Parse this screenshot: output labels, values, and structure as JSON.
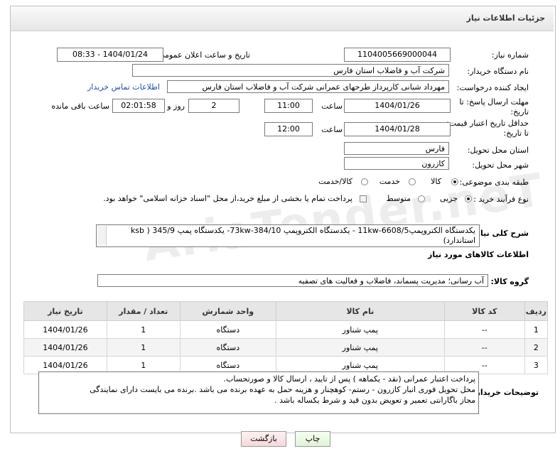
{
  "header": {
    "title": "جزئیات اطلاعات نیاز"
  },
  "form": {
    "need_number_label": "شماره نیاز:",
    "need_number": "1104005669000044",
    "announce_label": "تاریخ و ساعت اعلان عمومی:",
    "announce_value": "1404/01/24 - 08:33",
    "buyer_label": "نام دستگاه خریدار:",
    "buyer_value": "شرکت آب و فاضلاب استان فارس",
    "requester_label": "ایجاد کننده درخواست:",
    "requester_value": "مهرداد شبانی کارپرداز طرحهای عمرانی  شرکت آب و فاضلاب استان فارس",
    "contact_link": "اطلاعات تماس خریدار",
    "send_deadline_label_1": "مهلت ارسال پاسخ: تا",
    "send_deadline_label_2": "تاریخ:",
    "send_date": "1404/01/26",
    "time_label": "ساعت",
    "send_time": "11:00",
    "days_value": "2",
    "days_label": "روز و",
    "remaining_value": "02:01:58",
    "remaining_label": "ساعت باقی مانده",
    "price_deadline_label_1": "حداقل تاریخ اعتبار قیمت:",
    "price_deadline_label_2": "تا تاریخ:",
    "price_date": "1404/01/28",
    "price_time": "12:00",
    "province_label": "استان محل تحویل:",
    "province_value": "فارس",
    "city_label": "شهر محل تحویل:",
    "city_value": "کازرون",
    "category_label": "طبقه بندی موضوعی:",
    "category_options": [
      "کالا",
      "خدمت",
      "کالا/خدمت"
    ],
    "process_label": "نوع فرآیند خرید :",
    "process_options": [
      "جزیی",
      "متوسط"
    ],
    "payment_note": "پرداخت تمام یا بخشی از مبلغ خرید،از محل \"اسناد خزانه اسلامی\" خواهد بود.",
    "summary_label": "شرح کلی نیاز:",
    "summary_line1": "یکدستگاه الکتروپمپ11kw-6608/5 - یکدستگاه الکتروپمپ 73kw-384/10-  یکدستگاه پمپ 345/9  ( ksb",
    "summary_line2": "استاندارد)"
  },
  "goods": {
    "section_title": "اطلاعات کالاهای مورد نیاز",
    "group_label": "گروه کالا:",
    "group_value": "آب رسانی؛ مدیریت پسماند، فاضلاب و فعالیت های تصفیه",
    "columns": [
      "ردیف",
      "کد کالا",
      "نام کالا",
      "واحد شمارش",
      "تعداد / مقدار",
      "تاریخ نیاز"
    ],
    "rows": [
      {
        "row": "1",
        "code": "--",
        "name": "پمپ شناور",
        "unit": "دستگاه",
        "qty": "1",
        "date": "1404/01/26"
      },
      {
        "row": "2",
        "code": "--",
        "name": "پمپ شناور",
        "unit": "دستگاه",
        "qty": "1",
        "date": "1404/01/26"
      },
      {
        "row": "3",
        "code": "--",
        "name": "پمپ شناور",
        "unit": "دستگاه",
        "qty": "1",
        "date": "1404/01/26"
      }
    ]
  },
  "buyer_notes": {
    "label": "توضیحات خریدار:",
    "lines": [
      "پرداخت اعتبار  عمرانی  (نقد -  یکماهه ) پس از تایید ، ارسال کالا  و صورتحساب.",
      "محل تحویل فوری انبار کازرون - رستم- کوهچنار   و هزینه حمل به عهده برنده می باشد .برنده می بایست دارای نمایندگی",
      "مجاز باگارانتی تعمیر و تعویض بدون قید و شرط یکساله باشد ."
    ]
  },
  "buttons": {
    "print": "چاپ",
    "back": "بازگشت"
  },
  "watermark": "AriaTender.neT"
}
